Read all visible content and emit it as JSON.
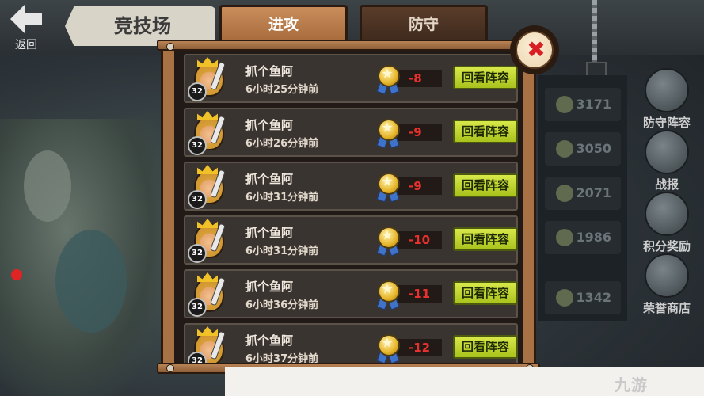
{
  "header": {
    "back_label": "返回",
    "title": "竞技场"
  },
  "tabs": [
    {
      "label": "进攻",
      "active": true
    },
    {
      "label": "防守",
      "active": false
    }
  ],
  "records": [
    {
      "name": "抓个鱼阿",
      "level": "32",
      "time": "6小时25分钟前",
      "score": "-8",
      "button": "回看阵容"
    },
    {
      "name": "抓个鱼阿",
      "level": "32",
      "time": "6小时26分钟前",
      "score": "-9",
      "button": "回看阵容"
    },
    {
      "name": "抓个鱼阿",
      "level": "32",
      "time": "6小时31分钟前",
      "score": "-9",
      "button": "回看阵容"
    },
    {
      "name": "抓个鱼阿",
      "level": "32",
      "time": "6小时31分钟前",
      "score": "-10",
      "button": "回看阵容"
    },
    {
      "name": "抓个鱼阿",
      "level": "32",
      "time": "6小时36分钟前",
      "score": "-11",
      "button": "回看阵容"
    },
    {
      "name": "抓个鱼阿",
      "level": "32",
      "time": "6小时37分钟前",
      "score": "-12",
      "button": "回看阵容"
    }
  ],
  "background_scores": [
    "3171",
    "3050",
    "2071",
    "1986",
    "1342"
  ],
  "side_menu": [
    {
      "label": "防守阵容",
      "icon": "shield-icon"
    },
    {
      "label": "战报",
      "icon": "scroll-icon"
    },
    {
      "label": "积分奖励",
      "icon": "chest-icon"
    },
    {
      "label": "荣誉商店",
      "icon": "shop-icon"
    }
  ],
  "close_icon": "close-icon",
  "watermark": "九游",
  "colors": {
    "panel_wood": "#a87245",
    "active_tab": "#c98d5c",
    "score_red": "#e8312c",
    "replay_green": "#c3d834",
    "close_x_red": "#d91f24"
  }
}
